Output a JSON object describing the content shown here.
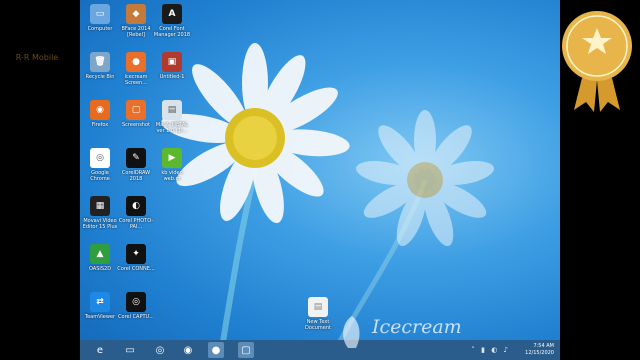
{
  "desktop": {
    "icons": [
      {
        "label": "Computer",
        "icon": "computer-icon",
        "color": "#6aa7e0",
        "glyph": "▭"
      },
      {
        "label": "BFace 2014 [Rebel]",
        "icon": "app-icon",
        "color": "#c47a3b",
        "glyph": "◆"
      },
      {
        "label": "Corel Font Manager 2018",
        "icon": "corel-font-icon",
        "color": "#1a1a1a",
        "glyph": "A"
      },
      {
        "label": "Recycle Bin",
        "icon": "recycle-bin-icon",
        "color": "#7da6c9",
        "glyph": "🗑"
      },
      {
        "label": "Icecream Screen...",
        "icon": "icecream-recorder-icon",
        "color": "#e8702a",
        "glyph": "●"
      },
      {
        "label": "Untitled-1",
        "icon": "image-file-icon",
        "color": "#b03a2e",
        "glyph": "▣"
      },
      {
        "label": "Firefox",
        "icon": "firefox-icon",
        "color": "#e66b1f",
        "glyph": "◉"
      },
      {
        "label": "Screenshot",
        "icon": "screenshot-icon",
        "color": "#e8702a",
        "glyph": "▢"
      },
      {
        "label": "Mal & METAL ver 1.0 (1)...",
        "icon": "document-icon",
        "color": "#d8e2ea",
        "glyph": "▤"
      },
      {
        "label": "Google Chrome",
        "icon": "chrome-icon",
        "color": "#ffffff",
        "glyph": "◎"
      },
      {
        "label": "CorelDRAW 2018",
        "icon": "coreldraw-icon",
        "color": "#111111",
        "glyph": "✎"
      },
      {
        "label": "kb video web.m",
        "icon": "video-file-icon",
        "color": "#5cb82e",
        "glyph": "▶"
      },
      {
        "label": "Movavi Video Editor 15 Plus",
        "icon": "movavi-icon",
        "color": "#222222",
        "glyph": "▦"
      },
      {
        "label": "Corel PHOTO-PAI...",
        "icon": "corel-photo-icon",
        "color": "#111111",
        "glyph": "◐"
      },
      {
        "label": "",
        "icon": "",
        "color": "",
        "glyph": ""
      },
      {
        "label": "OASIS2D",
        "icon": "oasis-icon",
        "color": "#2f9e3f",
        "glyph": "▲"
      },
      {
        "label": "Corel CONNE...",
        "icon": "corel-connect-icon",
        "color": "#111111",
        "glyph": "✦"
      },
      {
        "label": "",
        "icon": "",
        "color": "",
        "glyph": ""
      },
      {
        "label": "TeamViewer",
        "icon": "teamviewer-icon",
        "color": "#1e88e5",
        "glyph": "⇄"
      },
      {
        "label": "Corel CAPTU...",
        "icon": "corel-capture-icon",
        "color": "#111111",
        "glyph": "◎"
      },
      {
        "label": "",
        "icon": "",
        "color": "",
        "glyph": ""
      }
    ],
    "loose_icon": {
      "label": "New Text Document",
      "icon": "text-file-icon",
      "color": "#f2f2f2",
      "glyph": "▤"
    }
  },
  "taskbar": {
    "items": [
      {
        "name": "internet-explorer-icon",
        "glyph": "e",
        "active": false
      },
      {
        "name": "file-explorer-icon",
        "glyph": "▭",
        "active": false
      },
      {
        "name": "chrome-icon",
        "glyph": "◎",
        "active": false
      },
      {
        "name": "firefox-icon",
        "glyph": "◉",
        "active": false
      },
      {
        "name": "icecream-recorder-icon",
        "glyph": "●",
        "active": true
      },
      {
        "name": "screenshot-icon",
        "glyph": "▢",
        "active": true
      }
    ],
    "tray_icons": "˄ ▮ ◐ ♪",
    "time": "7:54 AM",
    "date": "12/15/2020"
  },
  "badge": {
    "text": "R-R Mobile",
    "color": "#e8b54a"
  },
  "watermark": {
    "text": "Icecream"
  }
}
